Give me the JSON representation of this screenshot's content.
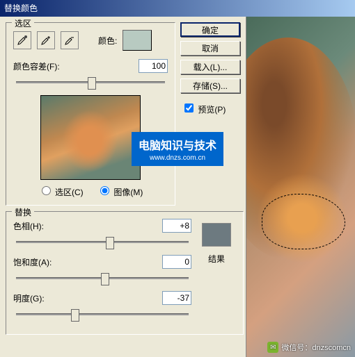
{
  "window": {
    "title": "替换颜色"
  },
  "selection_group": {
    "label": "选区",
    "color_label": "颜色:",
    "color_swatch": "#b8cac1",
    "fuzziness_label": "颜色容差(F):",
    "fuzziness_value": "100",
    "radio_selection": "选区(C)",
    "radio_image": "图像(M)",
    "radio_checked": "image"
  },
  "buttons": {
    "ok": "确定",
    "cancel": "取消",
    "load": "载入(L)...",
    "save": "存储(S)...",
    "preview_label": "预览(P)"
  },
  "replace_group": {
    "label": "替换",
    "hue_label": "色相(H):",
    "hue_value": "+8",
    "saturation_label": "饱和度(A):",
    "saturation_value": "0",
    "lightness_label": "明度(G):",
    "lightness_value": "-37",
    "result_label": "结果",
    "result_color": "#6d7a80"
  },
  "watermark": {
    "main": "电脑知识与技术",
    "sub": "www.dnzs.com.cn"
  },
  "footer": {
    "text": "微信号：dnzscomcn"
  }
}
